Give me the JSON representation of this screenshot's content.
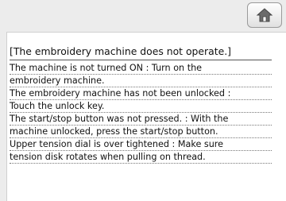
{
  "header": {
    "home_button_icon": "home-icon"
  },
  "message": {
    "title": "[The embroidery machine does not operate.]",
    "lines": [
      "The machine is not turned ON : Turn on the",
      "embroidery machine.",
      "The embroidery machine has not been unlocked :",
      "Touch the unlock key.",
      "The start/stop button was not pressed. : With the",
      "machine unlocked, press the start/stop button.",
      "Upper tension dial is over tightened : Make sure",
      "tension disk rotates when pulling on thread."
    ]
  },
  "colors": {
    "background": "#ececec",
    "panel": "#ffffff",
    "home_icon": "#5a5a5a"
  }
}
